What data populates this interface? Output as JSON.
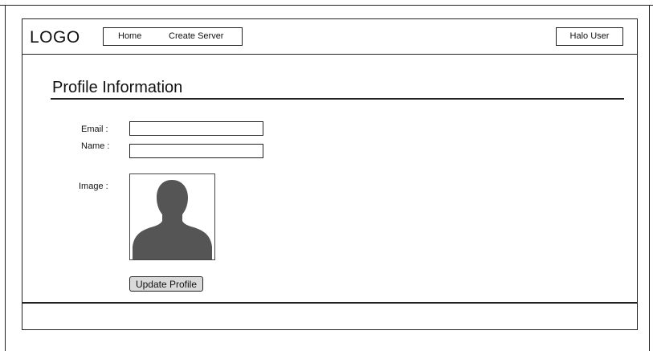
{
  "header": {
    "logo": "LOGO",
    "nav": [
      {
        "label": "Home"
      },
      {
        "label": "Create Server"
      }
    ],
    "user_button": "Halo User"
  },
  "main": {
    "title": "Profile Information",
    "fields": {
      "email_label": "Email :",
      "email_value": "",
      "name_label": "Name :",
      "name_value": "",
      "image_label": "Image :"
    },
    "avatar_icon": "person-silhouette-icon",
    "update_button": "Update Profile"
  },
  "colors": {
    "stroke": "#222222",
    "avatar_fill": "#555555",
    "button_fill": "#d9d9d9"
  }
}
